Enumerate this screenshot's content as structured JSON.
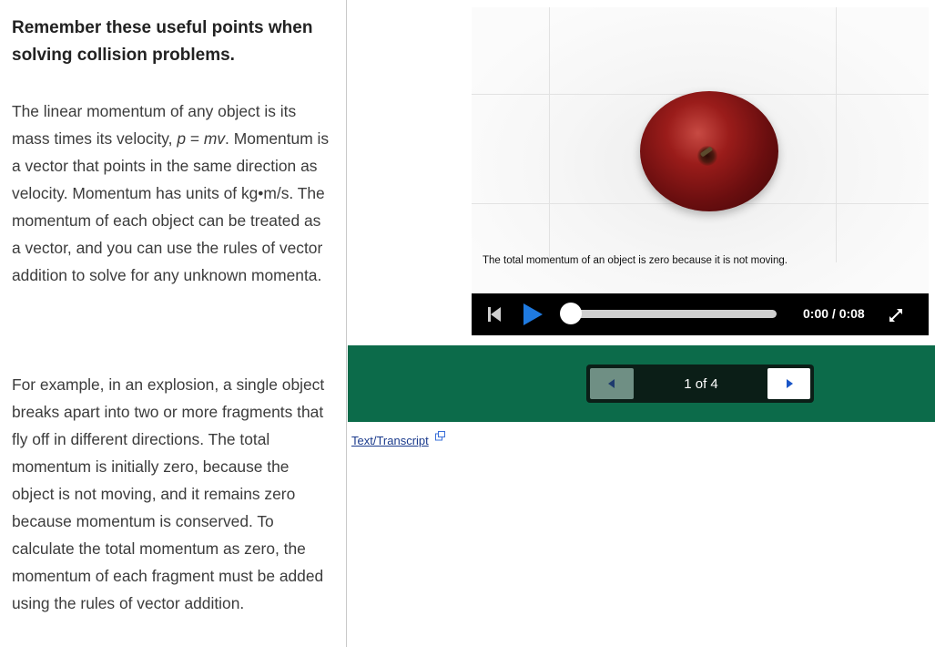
{
  "left": {
    "heading": "Remember these useful points when solving collision problems.",
    "para1_before_eq": "The linear momentum of any object is its mass times its velocity, ",
    "para1_eq_p": "p",
    "para1_eq_mid": " = ",
    "para1_eq_mv": "mv",
    "para1_after_eq": ". Momentum is a vector that points in the same direction as velocity. Momentum has units of kg•m/s. The momentum of each object can be treated as a vector, and you can use the rules of vector addition to solve for any unknown momenta.",
    "para2": "For example, in an explosion, a single object breaks apart into two or more fragments that fly off in different directions. The total momentum is initially zero, because the object is not moving, and it remains zero because momentum is conserved. To calculate the total momentum as zero, the momentum of each fragment must be added using the rules of vector addition."
  },
  "video": {
    "caption": "The total momentum of an object is zero because it is not moving.",
    "time": "0:00 / 0:08",
    "progress": 0.0
  },
  "pager": {
    "label": "1 of 4"
  },
  "transcript": {
    "link": "Text/Transcript"
  },
  "colors": {
    "pager_green": "#0c6b4a",
    "control_bar": "#000000"
  }
}
